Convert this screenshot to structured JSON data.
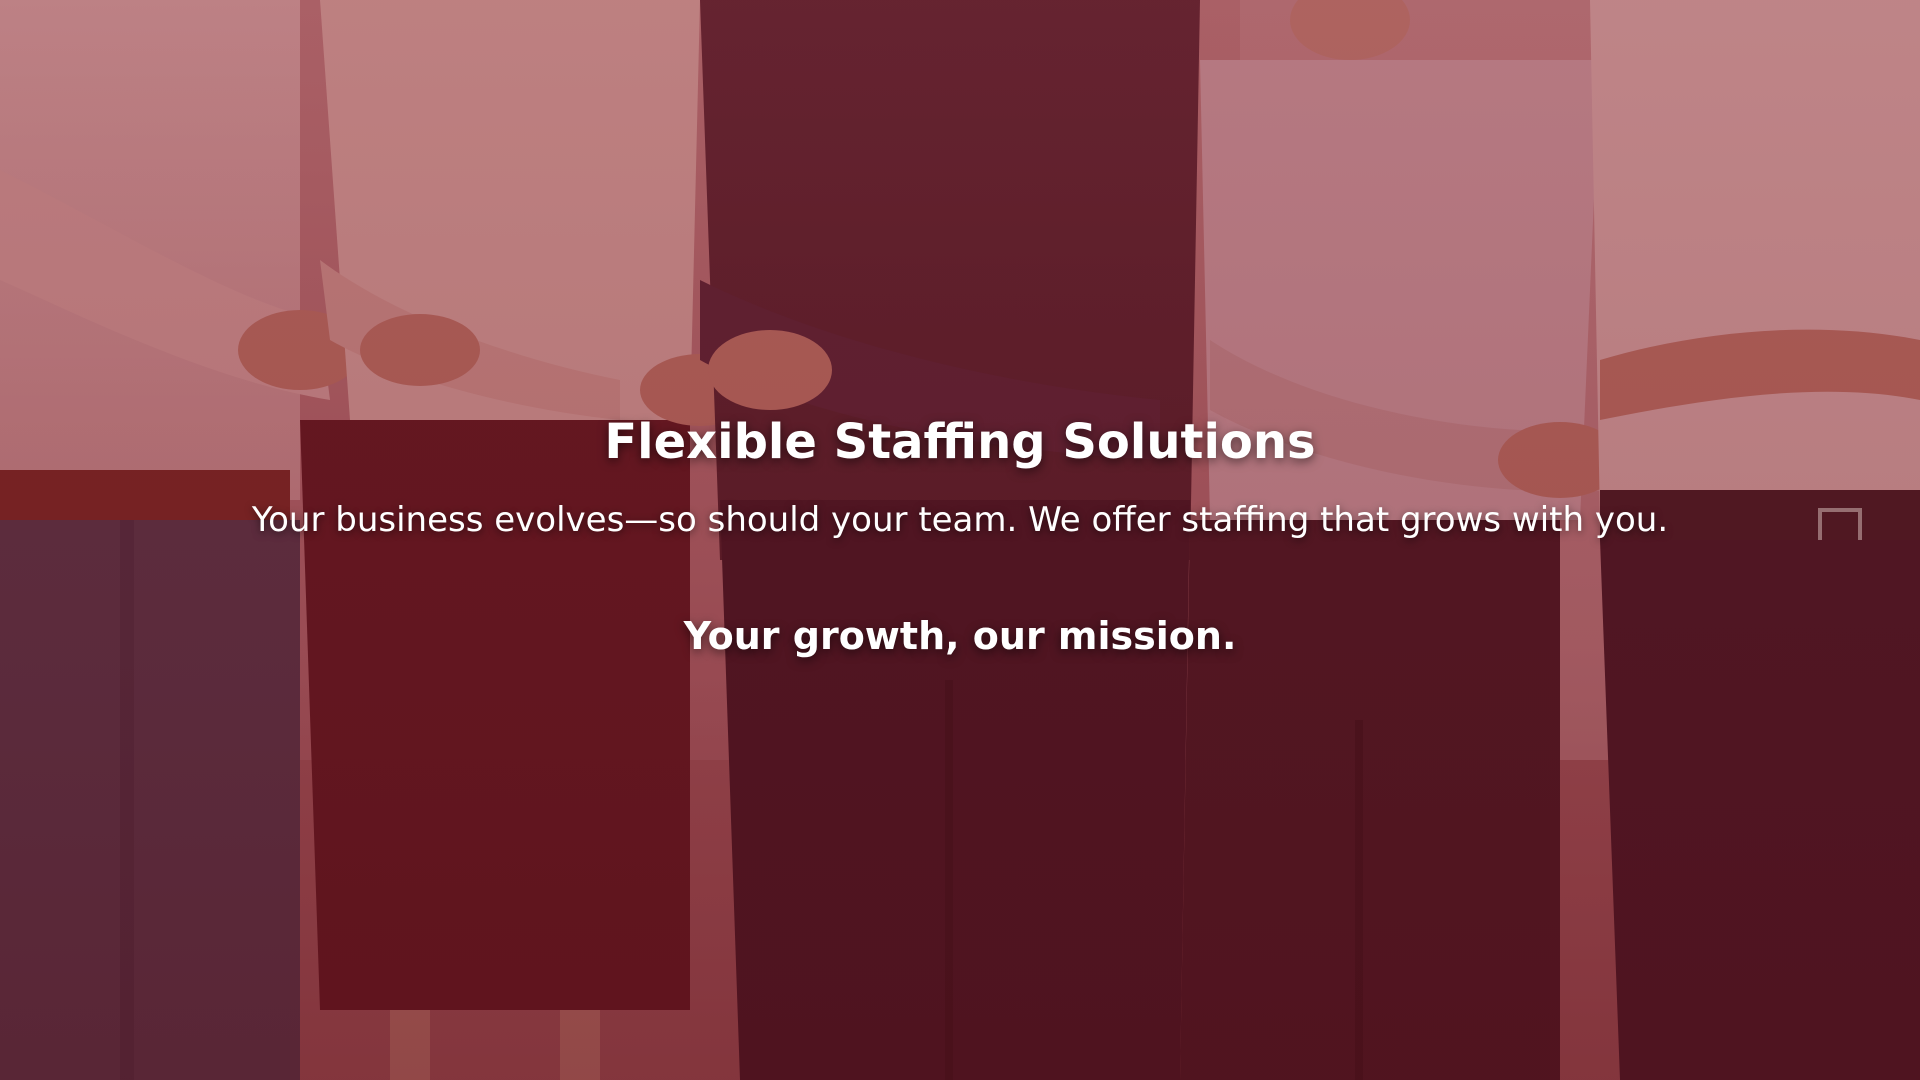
{
  "hero": {
    "title": "Flexible Staffing Solutions",
    "subtitle": "Your business evolves—so should your team. We offer staffing that grows with you.",
    "tagline": "Your growth, our mission."
  },
  "colors": {
    "overlay": "#7a1c24",
    "text": "#ffffff"
  }
}
